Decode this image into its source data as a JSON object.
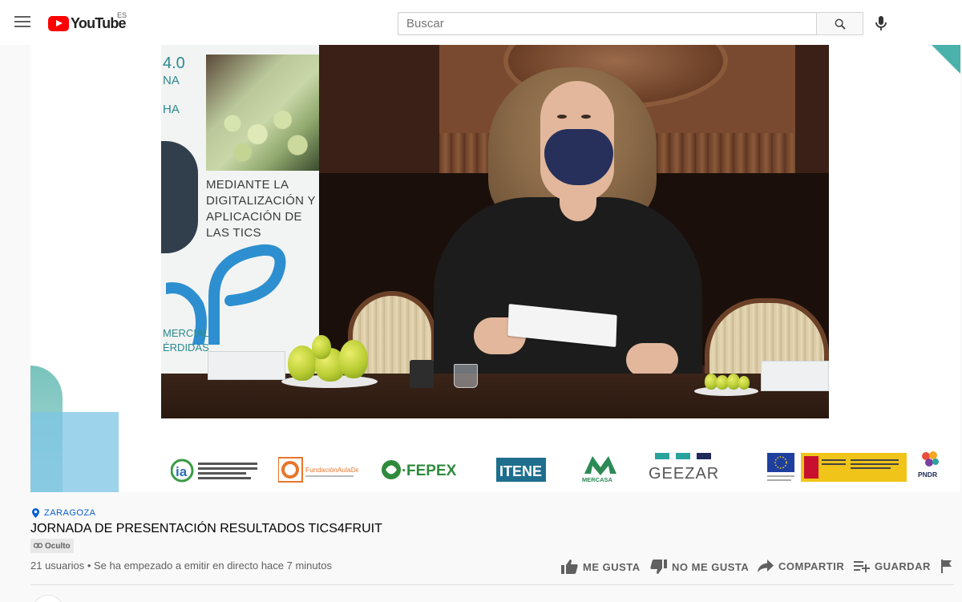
{
  "header": {
    "logo_text": "YouTube",
    "region": "ES",
    "search_placeholder": "Buscar"
  },
  "video": {
    "banner": {
      "line1": "4.0",
      "line2": "NA",
      "line3": "HA",
      "text": "MEDIANTE LA DIGITALIZACIÓN Y APLICACIÓN DE LAS TICS",
      "bottom1": "MERCIAL",
      "bottom2": "ÉRDIDAS"
    },
    "sponsors": [
      {
        "name": "ia"
      },
      {
        "name": "FundaciónAulaDei"
      },
      {
        "name": "FEPEX"
      },
      {
        "name": "ITENE"
      },
      {
        "name": "MERCASA"
      },
      {
        "name": "GEEZAR"
      },
      {
        "name": "PNDR"
      }
    ]
  },
  "info": {
    "location": "ZARAGOZA",
    "title": "JORNADA DE PRESENTACIÓN RESULTADOS TICS4FRUIT",
    "privacy": "Oculto",
    "meta": "21 usuarios • Se ha empezado a emitir en directo hace 7 minutos"
  },
  "actions": {
    "like": "ME GUSTA",
    "dislike": "NO ME GUSTA",
    "share": "COMPARTIR",
    "save": "GUARDAR"
  },
  "colors": {
    "brand_red": "#ff0000",
    "link_blue": "#065fd4",
    "teal": "#2aa39c"
  }
}
